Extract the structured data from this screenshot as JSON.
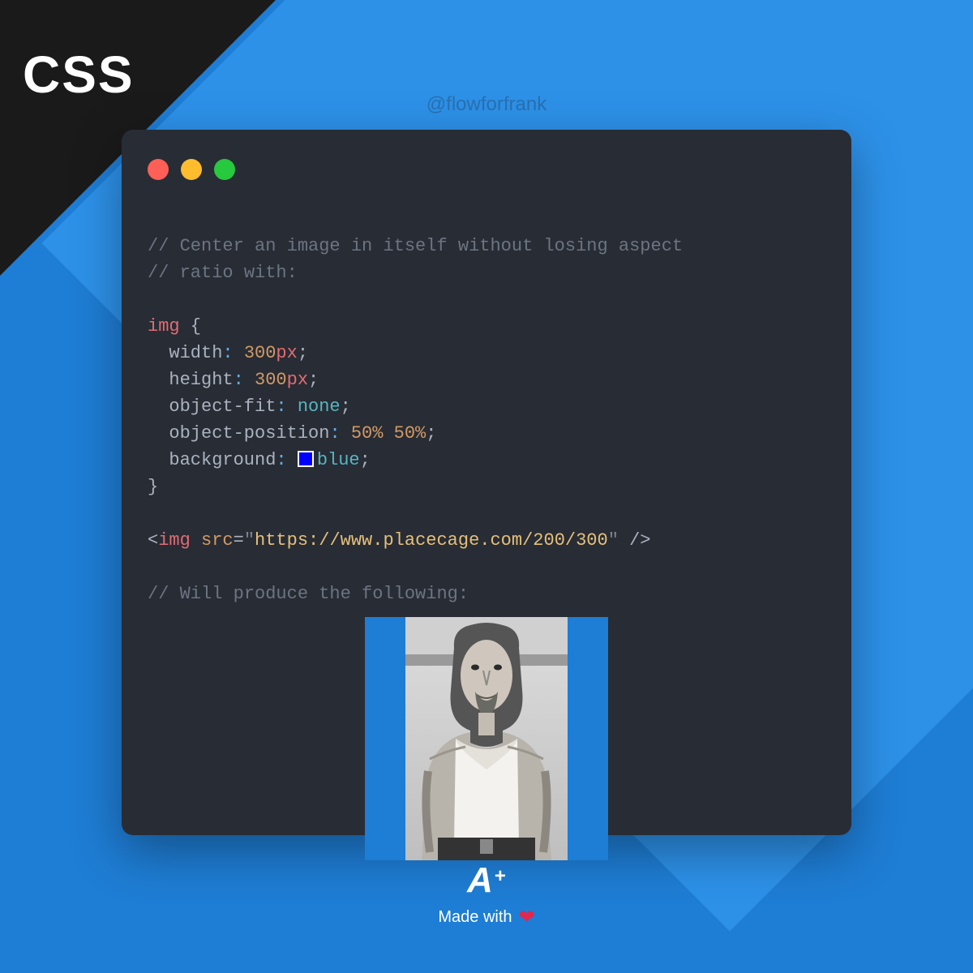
{
  "corner_label": "CSS",
  "handle": "@flowforfrank",
  "code": {
    "comment1": "// Center an image in itself without losing aspect",
    "comment2": "// ratio with:",
    "selector": "img",
    "brace_open": " {",
    "prop_width": "width",
    "val_width_num": "300",
    "val_width_unit": "px",
    "prop_height": "height",
    "val_height_num": "300",
    "val_height_unit": "px",
    "prop_objfit": "object-fit",
    "val_objfit": "none",
    "prop_objpos": "object-position",
    "val_objpos_1": "50%",
    "val_objpos_2": "50%",
    "prop_bg": "background",
    "val_bg": "blue",
    "brace_close": "}",
    "tag_open": "<",
    "tag_name": "img",
    "attr_src": "src",
    "attr_eq": "=",
    "quote": "\"",
    "url": "https://www.placecage.com/200/300",
    "tag_close": " />",
    "comment3": "// Will produce the following:",
    "colon": ": ",
    "semi": ";"
  },
  "footer": {
    "logo_a": "A",
    "logo_plus": "+",
    "made_with": "Made with"
  }
}
